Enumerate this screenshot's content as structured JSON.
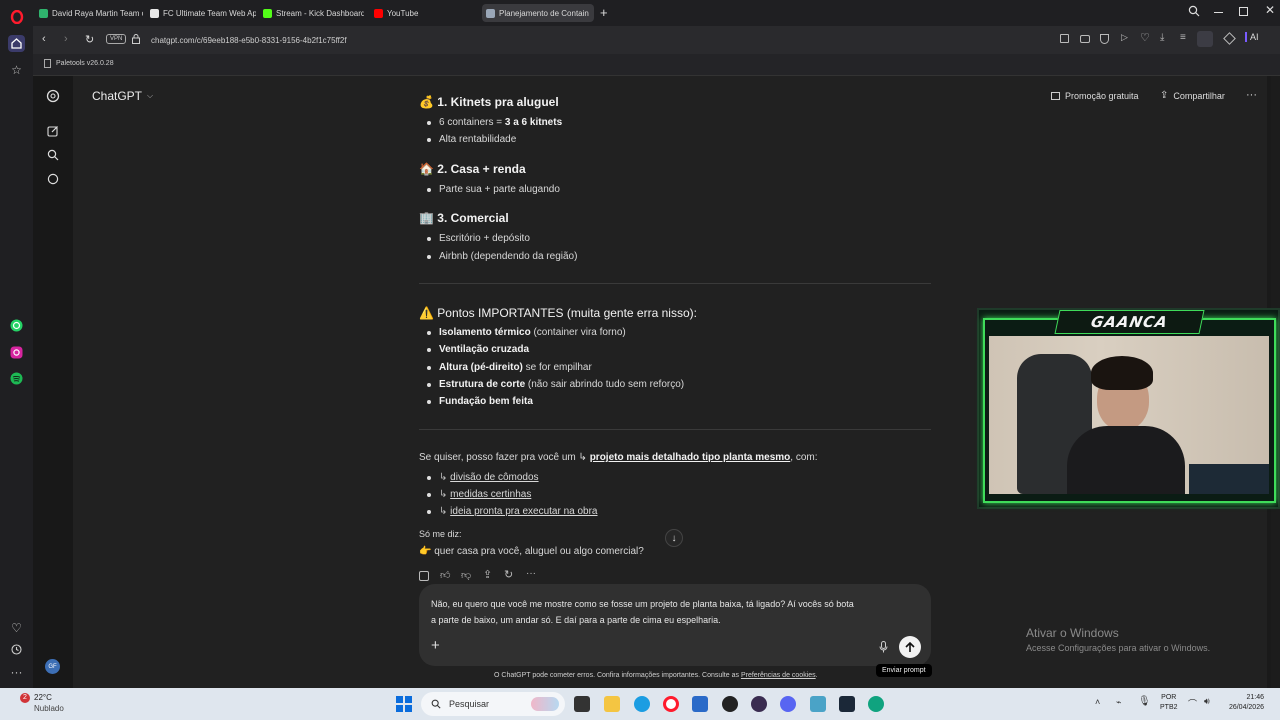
{
  "browser": {
    "tabs": [
      {
        "label": "David Raya Martin Team or",
        "color": "#2fb36d"
      },
      {
        "label": "FC Ultimate Team Web App",
        "color": "#e8e8e8"
      },
      {
        "label": "Stream - Kick Dashboard",
        "color": "#53fc18"
      },
      {
        "label": "YouTube",
        "color": "#ff0000"
      },
      {
        "label": "Planejamento de Contain",
        "color": "#9aa7b8"
      }
    ],
    "url": "chatgpt.com/c/69eeb188-e5b0-8331-9156-4b2f1c75ff2f",
    "vpn": "VPN",
    "bookmark": "Paletools v26.0.28",
    "ai_label": "AI"
  },
  "app": {
    "title": "ChatGPT",
    "promo": "Promoção gratuita",
    "share": "Compartilhar"
  },
  "content": {
    "s1_title": "1. Kitnets pra aluguel",
    "s1_b1_pre": "6 containers = ",
    "s1_b1_bold": "3 a 6 kitnets",
    "s1_b2": "Alta rentabilidade",
    "s2_title": "2. Casa + renda",
    "s2_b1": "Parte sua + parte alugando",
    "s3_title": "3. Comercial",
    "s3_b1": "Escritório + depósito",
    "s3_b2": "Airbnb (dependendo da região)",
    "warn_title": "Pontos IMPORTANTES (muita gente erra nisso):",
    "w1_bold": "Isolamento térmico",
    "w1_rest": " (container vira forno)",
    "w2_bold": "Ventilação cruzada",
    "w3_bold": "Altura (pé-direito)",
    "w3_rest": " se for empilhar",
    "w4_bold": "Estrutura de corte",
    "w4_rest": " (não sair abrindo tudo sem reforço)",
    "w5_bold": "Fundação bem feita",
    "offer_pre": "Se quiser, posso fazer pra você um ",
    "offer_arrow": "↳",
    "offer_link": "projeto mais detalhado tipo planta mesmo",
    "offer_post": ", com:",
    "o1": "divisão de cômodos",
    "o2": "medidas certinhas",
    "o3": "ideia pronta pra executar na obra",
    "ask": "Só me diz:",
    "question": "quer casa pra você, aluguel ou algo comercial?"
  },
  "composer": {
    "text_line1": "Não, eu quero que você me mostre como se fosse um projeto de planta baixa, tá ligado? Aí vocês só bota",
    "text_line2": "a parte de baixo, um andar só. E daí para a parte de cima eu espelharia.",
    "tooltip": "Enviar prompt",
    "disclaimer_pre": "O ChatGPT pode cometer erros. Confira informações importantes. Consulte as ",
    "disclaimer_link": "Preferências de cookies",
    "disclaimer_post": "."
  },
  "overlay": {
    "brand": "GAANCA",
    "activate_title": "Ativar o Windows",
    "activate_sub": "Acesse Configurações para ativar o Windows."
  },
  "taskbar": {
    "temp": "22°C",
    "weather": "Nublado",
    "weather_badge": "2",
    "search": "Pesquisar",
    "lang1": "POR",
    "lang2": "PTB2",
    "time": "21:46",
    "date": "26/04/2026"
  },
  "sidebar": {
    "avatar": "GF"
  }
}
